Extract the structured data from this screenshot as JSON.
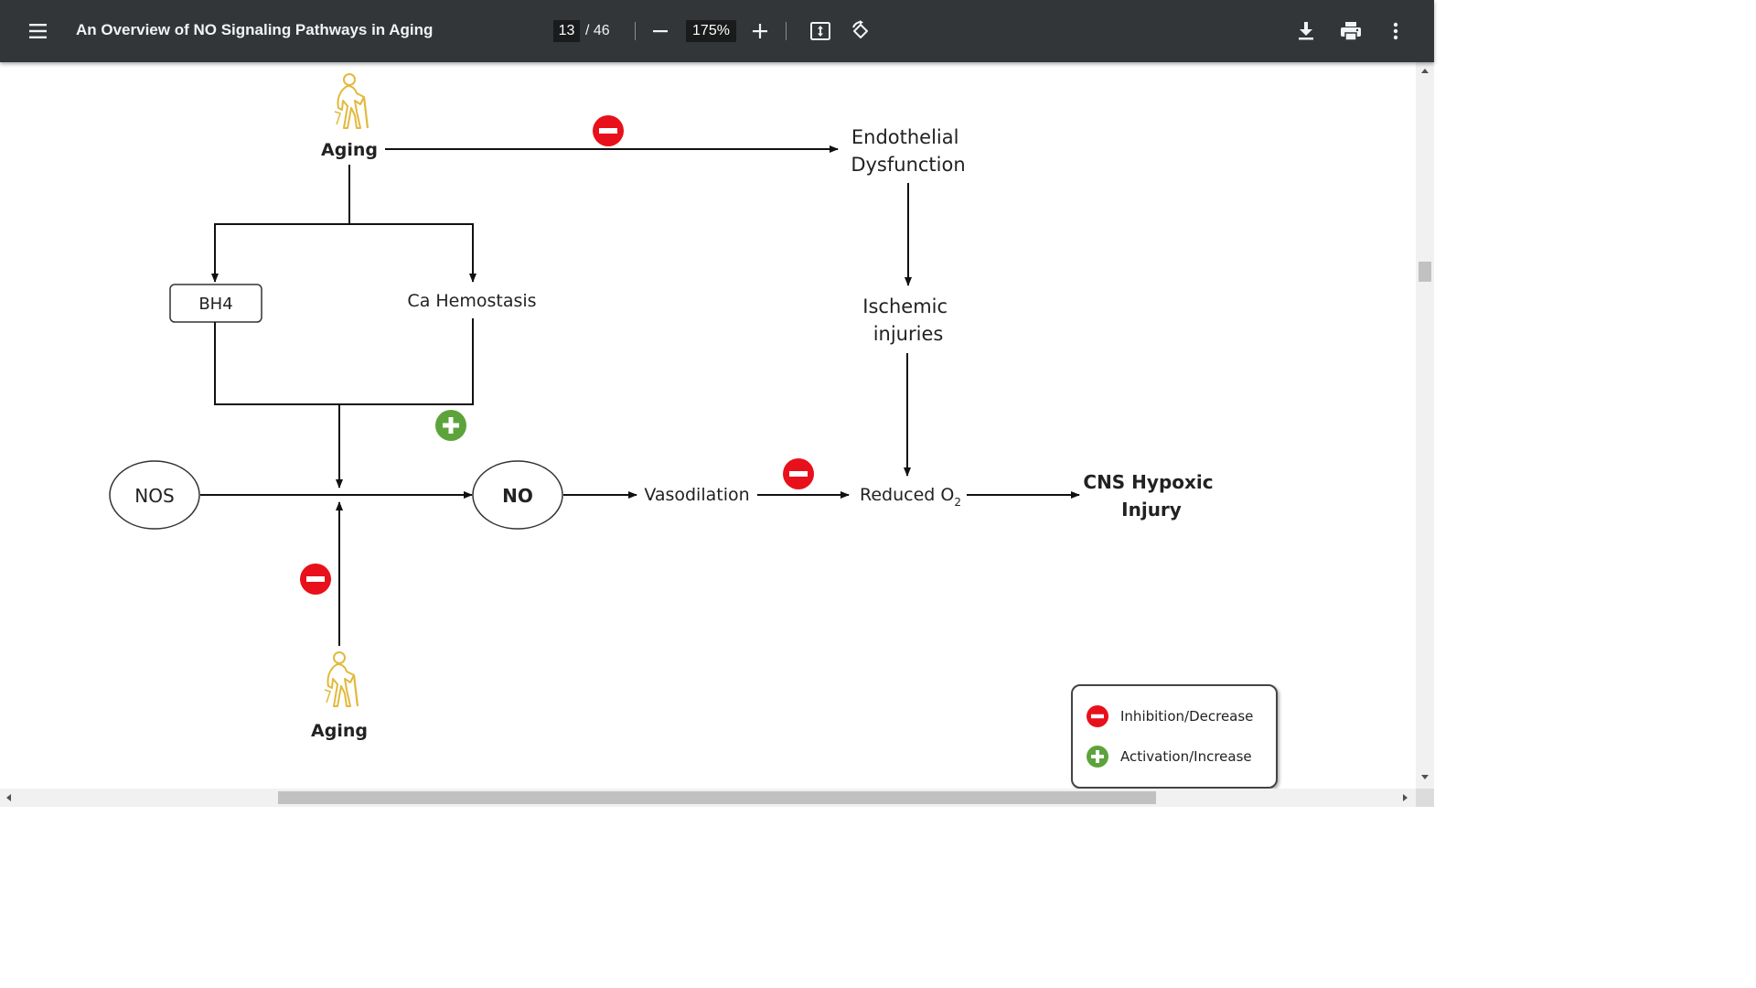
{
  "toolbar": {
    "title": "An Overview of NO Signaling Pathways in Aging",
    "page_current": "13",
    "page_total": "/ 46",
    "zoom": "175%",
    "icons": {
      "menu": "menu-icon",
      "zoom_out": "minus-icon",
      "zoom_in": "plus-icon",
      "fit": "fit-to-page-icon",
      "rotate": "rotate-icon",
      "download": "download-icon",
      "print": "print-icon",
      "more": "more-vert-icon"
    }
  },
  "diagram": {
    "aging_top": "Aging",
    "aging_bottom": "Aging",
    "bh4": "BH4",
    "ca_hemostasis": "Ca Hemostasis",
    "endothelial_line1": "Endothelial",
    "endothelial_line2": "Dysfunction",
    "ischemic_line1": "Ischemic",
    "ischemic_line2": "injuries",
    "nos": "NOS",
    "no": "NO",
    "vasodilation": "Vasodilation",
    "reduced_o2": "Reduced O",
    "reduced_o2_sub": "2",
    "cns_line1": "CNS Hypoxic",
    "cns_line2": "Injury"
  },
  "legend": {
    "inhibition": "Inhibition/Decrease",
    "activation": "Activation/Increase"
  },
  "colors": {
    "toolbar_bg": "#323639",
    "inhibition_red": "#e8101a",
    "activation_green": "#5da33b",
    "aging_figure": "#e2b93b"
  }
}
